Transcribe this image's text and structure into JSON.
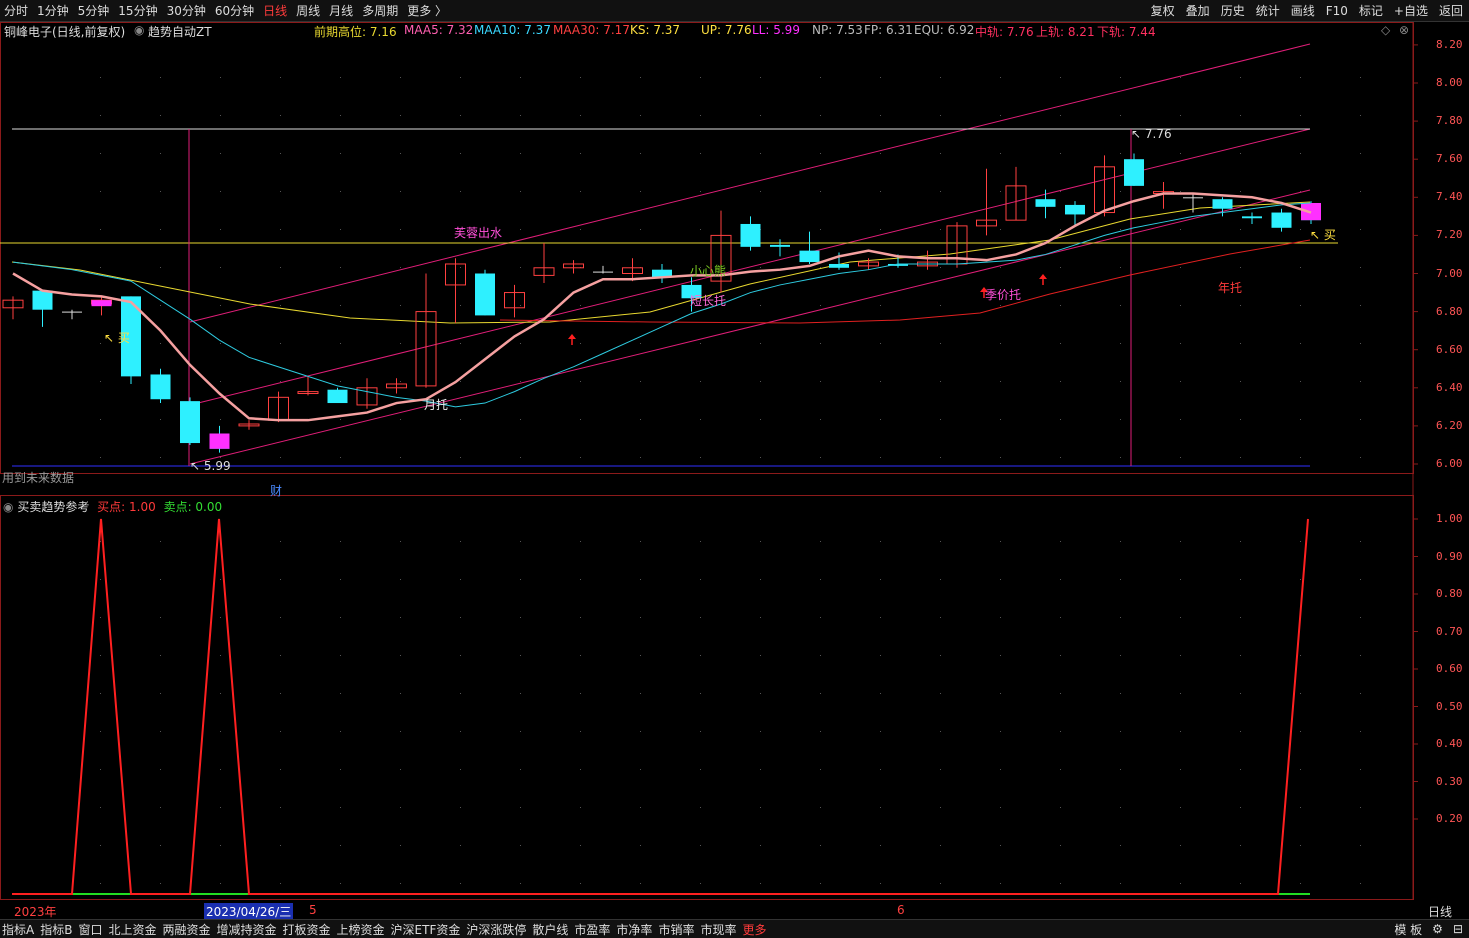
{
  "toolbar": {
    "periods": [
      "分时",
      "1分钟",
      "5分钟",
      "15分钟",
      "30分钟",
      "60分钟",
      "日线",
      "周线",
      "月线",
      "多周期",
      "更多 〉"
    ],
    "active_period": "日线",
    "right_buttons": [
      "复权",
      "叠加",
      "历史",
      "统计",
      "画线",
      "F10",
      "标记",
      "+自选",
      "返回"
    ]
  },
  "info": {
    "stock_name": "铜峰电子(日线,前复权)",
    "indicator": "趋势自动ZT",
    "prev_high": "前期高位: 7.16",
    "maa5": "MAA5: 7.32",
    "maa10": "MAA10: 7.37",
    "maa30": "MAA30: 7.17",
    "ks": "KS: 7.37",
    "up": "UP: 7.76",
    "ll": "LL: 5.99",
    "np": "NP: 7.53",
    "fp": "FP: 6.31",
    "equ": "EQU: 6.92",
    "mid": "中轨: 7.76",
    "upper": "上轨: 8.21",
    "lower": "下轨: 7.44"
  },
  "annotations": {
    "future_data": "用到未来数据",
    "cai": "财",
    "furong": "芙蓉出水",
    "xiaoxin": "小心熊",
    "duanchang": "短长托",
    "yuetuo": "月托",
    "jijiatuo": "季价托",
    "niantuo": "年托",
    "buy1": "买",
    "buy2": "买",
    "high_label": "7.76",
    "low_label": "5.99"
  },
  "price_axis": [
    "8.20",
    "8.00",
    "7.80",
    "7.60",
    "7.40",
    "7.20",
    "7.00",
    "6.80",
    "6.60",
    "6.40",
    "6.20",
    "6.00"
  ],
  "sub_indicator": {
    "title": "买卖趋势参考",
    "buy_point": "买点: 1.00",
    "sell_point": "卖点: 0.00"
  },
  "sub_axis": [
    "1.00",
    "0.90",
    "0.80",
    "0.70",
    "0.60",
    "0.50",
    "0.40",
    "0.30",
    "0.20"
  ],
  "date_axis": {
    "year": "2023年",
    "cursor_date": "2023/04/26/三",
    "m5": "5",
    "m6": "6",
    "period": "日线"
  },
  "bottom_tabs": [
    "指标A",
    "指标B",
    "窗口",
    "北上资金",
    "两融资金",
    "增减持资金",
    "打板资金",
    "上榜资金",
    "沪深ETF资金",
    "沪深涨跌停",
    "散户线",
    "市盈率",
    "市净率",
    "市销率",
    "市现率",
    "更多"
  ],
  "bottom_right": [
    "模 板",
    "⚙",
    "⊟"
  ],
  "chart_data": {
    "type": "candlestick",
    "candles": [
      [
        6.82,
        6.88,
        6.76,
        6.86
      ],
      [
        6.91,
        6.86,
        6.72,
        6.81
      ],
      [
        6.8,
        6.81,
        6.76,
        6.8
      ],
      [
        6.84,
        6.88,
        6.78,
        6.86
      ],
      [
        6.88,
        6.88,
        6.42,
        6.46
      ],
      [
        6.47,
        6.5,
        6.32,
        6.34
      ],
      [
        6.33,
        6.35,
        6.1,
        6.11
      ],
      [
        6.16,
        6.2,
        6.06,
        6.08
      ],
      [
        6.2,
        6.23,
        6.18,
        6.21
      ],
      [
        6.23,
        6.38,
        6.22,
        6.35
      ],
      [
        6.37,
        6.46,
        6.36,
        6.38
      ],
      [
        6.39,
        6.4,
        6.32,
        6.32
      ],
      [
        6.31,
        6.45,
        6.29,
        6.4
      ],
      [
        6.4,
        6.45,
        6.37,
        6.42
      ],
      [
        6.41,
        7.0,
        6.4,
        6.8
      ],
      [
        6.94,
        7.08,
        6.74,
        7.05
      ],
      [
        7.0,
        7.02,
        6.78,
        6.78
      ],
      [
        6.82,
        6.94,
        6.77,
        6.9
      ],
      [
        6.99,
        7.16,
        6.95,
        7.03
      ],
      [
        7.03,
        7.07,
        7.0,
        7.05
      ],
      [
        7.01,
        7.04,
        7.0,
        7.01
      ],
      [
        7.0,
        7.08,
        6.96,
        7.03
      ],
      [
        7.02,
        7.05,
        6.95,
        6.98
      ],
      [
        6.94,
        6.98,
        6.8,
        6.87
      ],
      [
        6.96,
        7.33,
        6.9,
        7.2
      ],
      [
        7.26,
        7.3,
        7.12,
        7.14
      ],
      [
        7.15,
        7.18,
        7.09,
        7.14
      ],
      [
        7.12,
        7.22,
        7.05,
        7.06
      ],
      [
        7.05,
        7.11,
        7.02,
        7.03
      ],
      [
        7.04,
        7.08,
        7.02,
        7.06
      ],
      [
        7.05,
        7.1,
        7.03,
        7.04
      ],
      [
        7.04,
        7.12,
        7.02,
        7.06
      ],
      [
        7.05,
        7.27,
        7.03,
        7.25
      ],
      [
        7.25,
        7.55,
        7.2,
        7.28
      ],
      [
        7.28,
        7.56,
        7.28,
        7.46
      ],
      [
        7.39,
        7.44,
        7.29,
        7.35
      ],
      [
        7.36,
        7.38,
        7.25,
        7.31
      ],
      [
        7.32,
        7.62,
        7.3,
        7.56
      ],
      [
        7.6,
        7.63,
        7.46,
        7.46
      ],
      [
        7.42,
        7.48,
        7.34,
        7.43
      ],
      [
        7.4,
        7.42,
        7.32,
        7.4
      ],
      [
        7.39,
        7.4,
        7.3,
        7.34
      ],
      [
        7.3,
        7.32,
        7.26,
        7.29
      ],
      [
        7.32,
        7.34,
        7.22,
        7.24
      ],
      [
        7.37,
        7.38,
        7.26,
        7.28
      ]
    ],
    "ma5": [
      7.0,
      6.91,
      6.89,
      6.88,
      6.85,
      6.7,
      6.52,
      6.37,
      6.24,
      6.23,
      6.23,
      6.25,
      6.27,
      6.32,
      6.34,
      6.43,
      6.55,
      6.67,
      6.76,
      6.9,
      6.97,
      6.97,
      6.98,
      6.99,
      6.99,
      7.01,
      7.02,
      7.04,
      7.09,
      7.12,
      7.09,
      7.08,
      7.08,
      7.07,
      7.1,
      7.16,
      7.25,
      7.33,
      7.38,
      7.42,
      7.42,
      7.41,
      7.4,
      7.37,
      7.32
    ],
    "ma10": [
      7.06,
      7.04,
      7.02,
      6.99,
      6.96,
      6.86,
      6.76,
      6.65,
      6.56,
      6.51,
      6.46,
      6.41,
      6.38,
      6.35,
      6.33,
      6.3,
      6.32,
      6.38,
      6.45,
      6.51,
      6.58,
      6.65,
      6.72,
      6.79,
      6.84,
      6.9,
      6.94,
      6.97,
      7.0,
      7.02,
      7.05,
      7.05,
      7.05,
      7.06,
      7.07,
      7.1,
      7.15,
      7.2,
      7.24,
      7.27,
      7.3,
      7.32,
      7.34,
      7.36,
      7.37
    ]
  }
}
